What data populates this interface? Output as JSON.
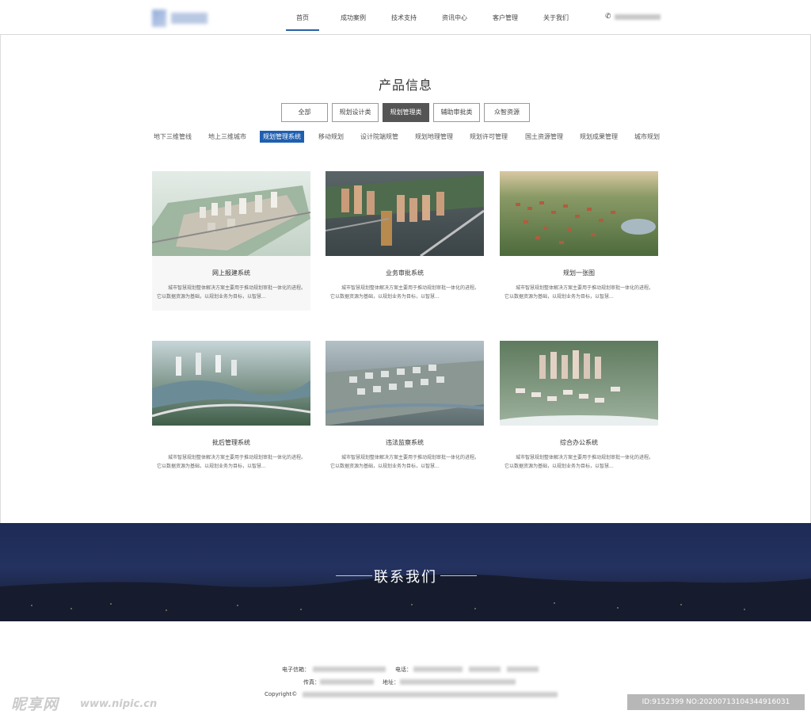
{
  "header": {
    "nav": [
      "首页",
      "成功案例",
      "技术支持",
      "资讯中心",
      "客户管理",
      "关于我们"
    ],
    "active_nav": "首页"
  },
  "products": {
    "title": "产品信息",
    "categories": [
      "全部",
      "规划设计类",
      "规划管理类",
      "辅助审批类",
      "众智资源"
    ],
    "active_category": "规划管理类",
    "subtabs": [
      "地下三维管线",
      "地上三维城市",
      "规划管理系统",
      "移动规划",
      "设计院端规管",
      "规划地理管理",
      "规划许可管理",
      "国土资源管理",
      "规划成果管理",
      "城市规划"
    ],
    "active_subtab": "规划管理系统",
    "cards": [
      {
        "title": "网上报建系统",
        "desc": "城市智慧规划整体解决方案主要用于推动规划审批一体化的进程。它以数据资源为基础，以规划业务为目标，以智慧..."
      },
      {
        "title": "业务审批系统",
        "desc": "城市智慧规划整体解决方案主要用于推动规划审批一体化的进程。它以数据资源为基础，以规划业务为目标，以智慧..."
      },
      {
        "title": "规划一张图",
        "desc": "城市智慧规划整体解决方案主要用于推动规划审批一体化的进程。它以数据资源为基础，以规划业务为目标，以智慧..."
      },
      {
        "title": "批后管理系统",
        "desc": "城市智慧规划整体解决方案主要用于推动规划审批一体化的进程。它以数据资源为基础，以规划业务为目标，以智慧..."
      },
      {
        "title": "违法监察系统",
        "desc": "城市智慧规划整体解决方案主要用于推动规划审批一体化的进程。它以数据资源为基础，以规划业务为目标，以智慧..."
      },
      {
        "title": "综合办公系统",
        "desc": "城市智慧规划整体解决方案主要用于推动规划审批一体化的进程。它以数据资源为基础，以规划业务为目标，以智慧..."
      }
    ]
  },
  "contact": {
    "title": "联系我们"
  },
  "footer": {
    "email_label": "电子信箱：",
    "phone_label": "电话：",
    "fax_label": "传真：",
    "address_label": "地址：",
    "copyright": "Copyright©"
  },
  "watermark": {
    "logo_text": "昵享网",
    "url": "www.nipic.cn",
    "id_text": "ID:9152399 NO:20200713104344916031"
  },
  "colors": {
    "accent": "#1f5fb0",
    "active_category_bg": "#555555",
    "contact_band": "#1d2a55"
  }
}
